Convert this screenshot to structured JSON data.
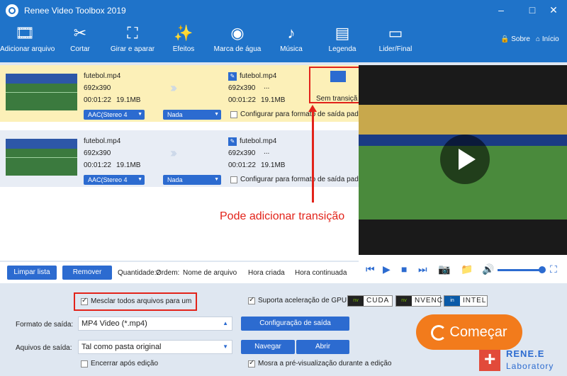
{
  "window": {
    "title": "Renee Video Toolbox 2019"
  },
  "toolbar": [
    {
      "label": "Adicionar arquivo",
      "icon": "add-file-icon"
    },
    {
      "label": "Cortar",
      "icon": "scissors-icon"
    },
    {
      "label": "Girar e aparar",
      "icon": "crop-icon"
    },
    {
      "label": "Efeitos",
      "icon": "effects-icon"
    },
    {
      "label": "Marca de água",
      "icon": "watermark-icon"
    },
    {
      "label": "Música",
      "icon": "music-icon"
    },
    {
      "label": "Legenda",
      "icon": "subtitle-icon"
    },
    {
      "label": "Lider/Final",
      "icon": "intro-outro-icon"
    }
  ],
  "header_right": {
    "about": "Sobre",
    "home": "Início"
  },
  "files": [
    {
      "name": "futebol.mp4",
      "resolution": "692x390",
      "duration": "00:01:22",
      "size": "19.1MB",
      "out_name": "futebol.mp4",
      "out_resolution": "692x390",
      "out_extra": "...",
      "out_duration": "00:01:22",
      "out_size": "19.1MB",
      "audio": "AAC(Stereo 4",
      "subtitle": "Nada",
      "config_label": "Configurar para formato de saída pad",
      "transition_label": "Sem transiçã"
    },
    {
      "name": "futebol.mp4",
      "resolution": "692x390",
      "duration": "00:01:22",
      "size": "19.1MB",
      "out_name": "futebol.mp4",
      "out_resolution": "692x390",
      "out_extra": "...",
      "out_duration": "00:01:22",
      "out_size": "19.1MB",
      "audio": "AAC(Stereo 4",
      "subtitle": "Nada",
      "config_label": "Configurar para formato de saída pad"
    }
  ],
  "annotation": "Pode adicionar transição",
  "list_actions": {
    "clear": "Limpar lista",
    "remove": "Remover",
    "qty_label": "Quantidade:2",
    "order_label": "Ordem:",
    "sort_name": "Nome de arquivo",
    "sort_created": "Hora criada",
    "sort_continuous": "Hora continuada"
  },
  "settings": {
    "merge_label": "Mesclar todos arquivos para um",
    "merge_checked": true,
    "gpu_label": "Suporta aceleração de GPU",
    "gpu_checked": true,
    "gpu_options": [
      "CUDA",
      "NVENC",
      "INTEL"
    ],
    "format_label": "Formato de saída:",
    "format_value": "MP4 Video (*.mp4)",
    "config_button": "Configuração de saída",
    "output_label": "Aquivos de saída:",
    "output_value": "Tal como pasta original",
    "browse_button": "Navegar",
    "open_button": "Abrir",
    "shutdown_label": "Encerrar após edição",
    "shutdown_checked": false,
    "preview_label": "Mosra a pré-visualização durante a edição",
    "preview_checked": true,
    "start_button": "Começar"
  },
  "watermark": {
    "line1": "RENE.E",
    "line2": "Laboratory"
  },
  "colors": {
    "brand_blue": "#1f73c9",
    "accent_orange": "#f27b1c",
    "annotation_red": "#e2231a"
  }
}
